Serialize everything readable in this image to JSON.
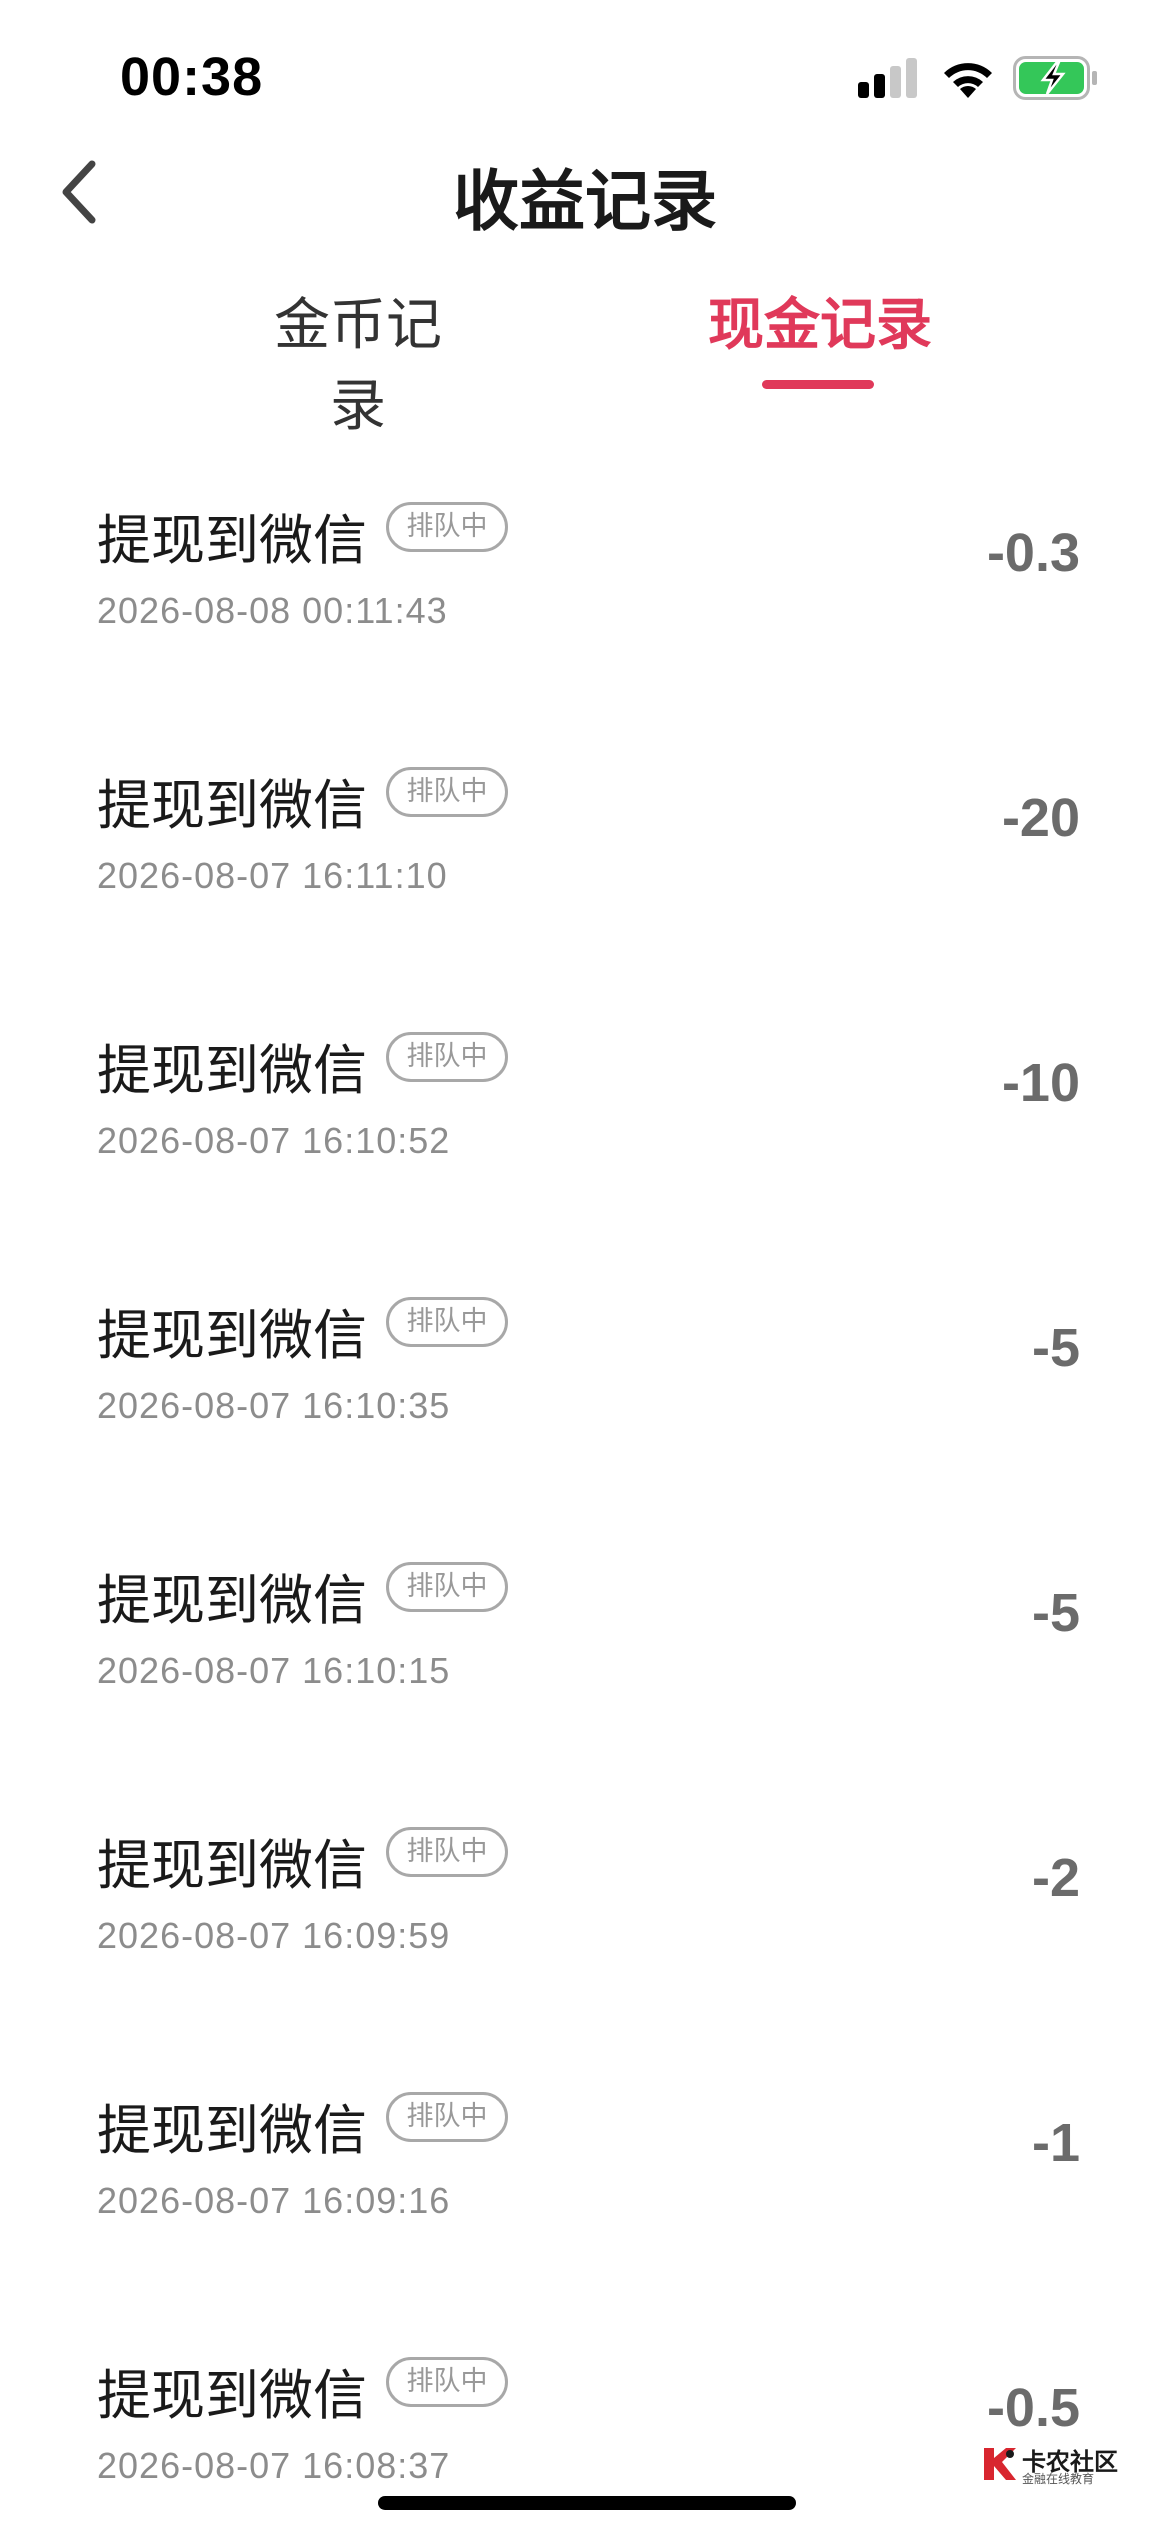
{
  "status_bar": {
    "time": "00:38",
    "icons": [
      "signal-icon",
      "wifi-icon",
      "battery-charging-icon"
    ]
  },
  "nav": {
    "title": "收益记录",
    "back_icon": "chevron-left-icon"
  },
  "tabs": [
    {
      "label": "金币记录",
      "active": false
    },
    {
      "label": "现金记录",
      "active": true
    }
  ],
  "colors": {
    "accent": "#e0395a",
    "amount": "#6b6b6b",
    "secondary_text": "#8c8c8c",
    "battery_fill": "#34c759"
  },
  "records": [
    {
      "title": "提现到微信",
      "status": "排队中",
      "datetime": "2026-08-08 00:11:43",
      "amount": "-0.3"
    },
    {
      "title": "提现到微信",
      "status": "排队中",
      "datetime": "2026-08-07 16:11:10",
      "amount": "-20"
    },
    {
      "title": "提现到微信",
      "status": "排队中",
      "datetime": "2026-08-07 16:10:52",
      "amount": "-10"
    },
    {
      "title": "提现到微信",
      "status": "排队中",
      "datetime": "2026-08-07 16:10:35",
      "amount": "-5"
    },
    {
      "title": "提现到微信",
      "status": "排队中",
      "datetime": "2026-08-07 16:10:15",
      "amount": "-5"
    },
    {
      "title": "提现到微信",
      "status": "排队中",
      "datetime": "2026-08-07 16:09:59",
      "amount": "-2"
    },
    {
      "title": "提现到微信",
      "status": "排队中",
      "datetime": "2026-08-07 16:09:16",
      "amount": "-1"
    },
    {
      "title": "提现到微信",
      "status": "排队中",
      "datetime": "2026-08-07 16:08:37",
      "amount": "-0.5"
    }
  ],
  "watermark": {
    "name": "卡农社区",
    "tagline": "金融在线教育"
  }
}
